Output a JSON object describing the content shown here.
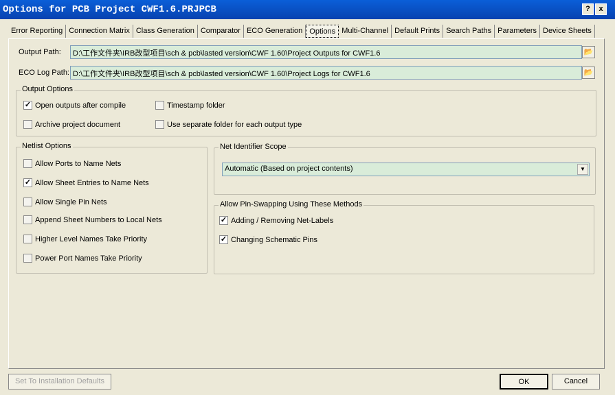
{
  "window": {
    "title": "Options for PCB Project CWF1.6.PRJPCB",
    "help": "?",
    "close": "x"
  },
  "tabs": [
    "Error Reporting",
    "Connection Matrix",
    "Class Generation",
    "Comparator",
    "ECO Generation",
    "Options",
    "Multi-Channel",
    "Default Prints",
    "Search Paths",
    "Parameters",
    "Device Sheets"
  ],
  "paths": {
    "output_label": "Output Path:",
    "output_value": "D:\\工作文件夹\\IRB改型项目\\sch & pcb\\lasted version\\CWF 1.60\\Project Outputs for CWF1.6",
    "eco_label": "ECO Log Path:",
    "eco_value": "D:\\工作文件夹\\IRB改型项目\\sch & pcb\\lasted version\\CWF 1.60\\Project Logs for CWF1.6"
  },
  "output_options": {
    "title": "Output Options",
    "items": [
      {
        "label": "Open outputs after compile",
        "checked": true
      },
      {
        "label": "Timestamp folder",
        "checked": false
      },
      {
        "label": "Archive project document",
        "checked": false
      },
      {
        "label": "Use separate folder for each output type",
        "checked": false
      }
    ]
  },
  "netlist": {
    "title": "Netlist Options",
    "items": [
      {
        "label": "Allow Ports to Name Nets",
        "checked": false
      },
      {
        "label": "Allow Sheet Entries to Name Nets",
        "checked": true
      },
      {
        "label": "Allow Single Pin Nets",
        "checked": false
      },
      {
        "label": "Append Sheet Numbers to Local Nets",
        "checked": false
      },
      {
        "label": "Higher Level Names Take Priority",
        "checked": false
      },
      {
        "label": "Power Port Names Take Priority",
        "checked": false
      }
    ]
  },
  "net_scope": {
    "title": "Net Identifier Scope",
    "value": "Automatic (Based on project contents)"
  },
  "pin_swap": {
    "title": "Allow Pin-Swapping Using These Methods",
    "items": [
      {
        "label": "Adding / Removing Net-Labels",
        "checked": true
      },
      {
        "label": "Changing Schematic Pins",
        "checked": true
      }
    ]
  },
  "buttons": {
    "defaults": "Set To Installation Defaults",
    "ok": "OK",
    "cancel": "Cancel"
  }
}
